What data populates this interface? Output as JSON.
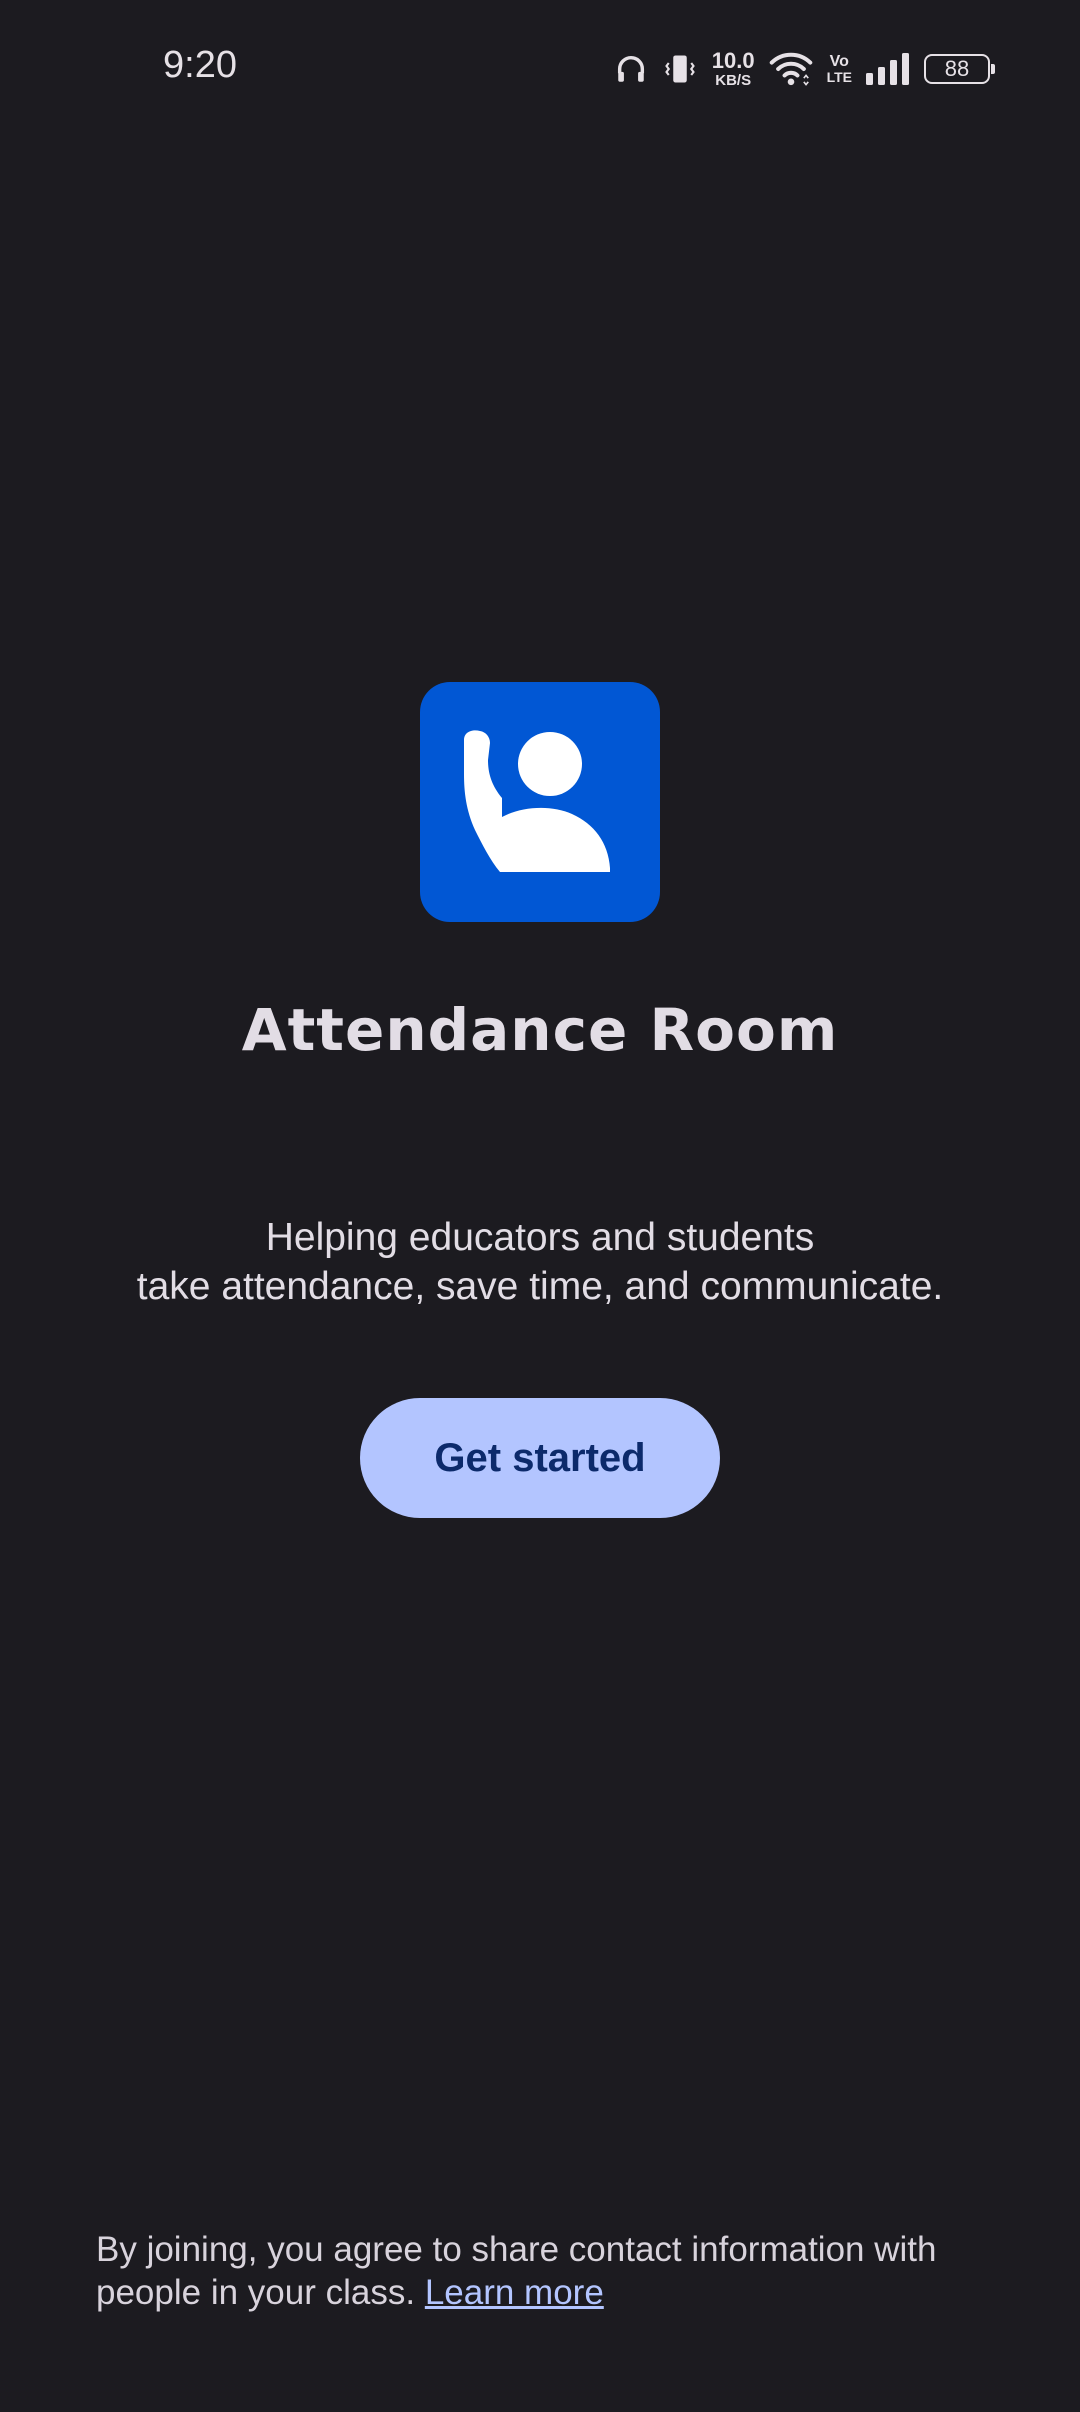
{
  "status_bar": {
    "time": "9:20",
    "net_speed_value": "10.0",
    "net_speed_unit": "KB/S",
    "volte_top": "Vo",
    "volte_bottom": "LTE",
    "battery_level": "88",
    "icons": [
      "headphones-icon",
      "vibrate-icon",
      "wifi-icon",
      "signal-icon",
      "battery-icon"
    ]
  },
  "app": {
    "logo_icon": "raised-hand-person-icon",
    "logo_color": "#0157d4",
    "title": "Attendance Room"
  },
  "tagline": {
    "line1": "Helping educators and students",
    "line2": "take attendance, save time, and communicate."
  },
  "cta": {
    "label": "Get started",
    "color": "#b3c5ff"
  },
  "footer": {
    "text": "By joining, you agree to share contact information with people in your class.",
    "link_label": "Learn more"
  }
}
